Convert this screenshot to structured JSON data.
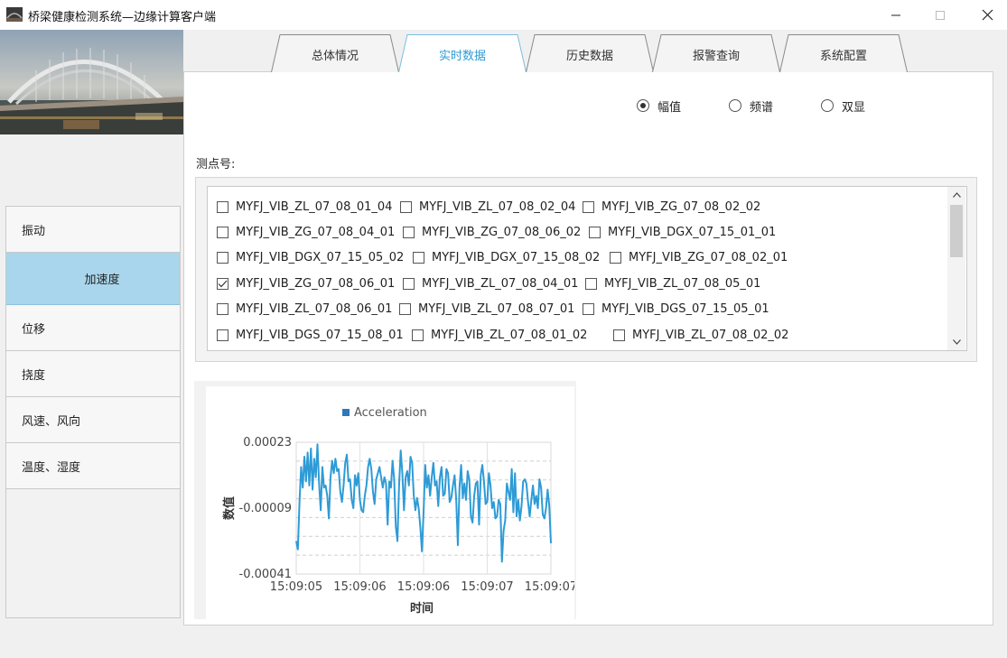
{
  "window": {
    "title": "桥梁健康检测系统—边缘计算客户端",
    "controls": {
      "minimize": "—",
      "maximize": "□",
      "close": "✕"
    }
  },
  "sidebar": {
    "items": [
      {
        "label": "振动",
        "active": false
      },
      {
        "label": "加速度",
        "active": true
      },
      {
        "label": "位移",
        "active": false
      },
      {
        "label": "挠度",
        "active": false
      },
      {
        "label": "风速、风向",
        "active": false
      },
      {
        "label": "温度、湿度",
        "active": false
      }
    ]
  },
  "tabs": [
    {
      "label": "总体情况",
      "active": false
    },
    {
      "label": "实时数据",
      "active": true
    },
    {
      "label": "历史数据",
      "active": false
    },
    {
      "label": "报警查询",
      "active": false
    },
    {
      "label": "系统配置",
      "active": false
    }
  ],
  "display_mode": {
    "options": [
      {
        "label": "幅值",
        "selected": true
      },
      {
        "label": "频谱",
        "selected": false
      },
      {
        "label": "双显",
        "selected": false
      }
    ]
  },
  "points": {
    "label": "测点号:",
    "rows": [
      [
        {
          "id": "MYFJ_VIB_ZL_07_08_01_04",
          "checked": false
        },
        {
          "id": "MYFJ_VIB_ZL_07_08_02_04",
          "checked": false
        },
        {
          "id": "MYFJ_VIB_ZG_07_08_02_02",
          "checked": false
        }
      ],
      [
        {
          "id": "MYFJ_VIB_ZG_07_08_04_01",
          "checked": false
        },
        {
          "id": "MYFJ_VIB_ZG_07_08_06_02",
          "checked": false
        },
        {
          "id": "MYFJ_VIB_DGX_07_15_01_01",
          "checked": false
        }
      ],
      [
        {
          "id": "MYFJ_VIB_DGX_07_15_05_02",
          "checked": false
        },
        {
          "id": "MYFJ_VIB_DGX_07_15_08_02",
          "checked": false
        },
        {
          "id": "MYFJ_VIB_ZG_07_08_02_01",
          "checked": false
        }
      ],
      [
        {
          "id": "MYFJ_VIB_ZG_07_08_06_01",
          "checked": true
        },
        {
          "id": "MYFJ_VIB_ZL_07_08_04_01",
          "checked": false
        },
        {
          "id": "MYFJ_VIB_ZL_07_08_05_01",
          "checked": false
        }
      ],
      [
        {
          "id": "MYFJ_VIB_ZL_07_08_06_01",
          "checked": false
        },
        {
          "id": "MYFJ_VIB_ZL_07_08_07_01",
          "checked": false
        },
        {
          "id": "MYFJ_VIB_DGS_07_15_05_01",
          "checked": false
        }
      ],
      [
        {
          "id": "MYFJ_VIB_DGS_07_15_08_01",
          "checked": false
        },
        {
          "id": "MYFJ_VIB_ZL_07_08_01_02",
          "checked": false
        },
        {
          "id": "MYFJ_VIB_ZL_07_08_02_02",
          "checked": false
        }
      ]
    ]
  },
  "chart_data": {
    "type": "line",
    "title": "",
    "xlabel": "时间",
    "ylabel": "数值",
    "legend": [
      "Acceleration"
    ],
    "legend_position": "top",
    "grid": true,
    "x_ticks": [
      "15:09:05",
      "15:09:06",
      "15:09:06",
      "15:09:07",
      "15:09:07"
    ],
    "y_ticks": [
      "0.00023",
      "-0.00009",
      "-0.00041"
    ],
    "ylim": [
      -0.00041,
      0.00023
    ],
    "series": [
      {
        "name": "Acceleration",
        "color": "#2e9bd6",
        "values": [
          -0.00025,
          -0.00029,
          -6e-05,
          0.00011,
          1e-05,
          0.00016,
          4e-05,
          0.00018,
          2e-05,
          0.0002,
          0.0,
          0.00015,
          6e-05,
          0.00022,
          3e-05,
          -0.0001,
          0.00011,
          1e-05,
          2e-05,
          -3e-05,
          -0.00014,
          6e-05,
          0.00014,
          8e-05,
          0.00015,
          9e-05,
          0.0001,
          -1e-05,
          -6e-05,
          2e-05,
          0.00013,
          0.00017,
          4e-05,
          5e-05,
          -5e-05,
          -9e-05,
          7e-05,
          2e-05,
          8e-05,
          -5e-05,
          -0.0001,
          -0.00011,
          -3e-05,
          2e-05,
          0.00011,
          0.00015,
          0.0001,
          -1e-05,
          -7e-05,
          5e-05,
          8e-05,
          0.00011,
          6e-05,
          1e-05,
          6e-05,
          3e-05,
          -0.00017,
          4e-05,
          1e-05,
          0.00014,
          5e-05,
          -0.00018,
          -0.00025,
          2e-05,
          0.00019,
          8e-05,
          -0.0001,
          6e-05,
          9e-05,
          2e-05,
          0.00016,
          0.00013,
          -3e-05,
          -0.0001,
          -4e-05,
          -9e-05,
          -0.00018,
          -0.0003,
          -0.00011,
          0.00012,
          1e-05,
          7e-05,
          -3e-05,
          6e-05,
          0.00013,
          2e-05,
          4e-05,
          -8e-05,
          6e-05,
          0.00011,
          -3e-05,
          -2e-05,
          0.0001,
          8e-05,
          -6e-05,
          -4e-05,
          2e-05,
          7e-05,
          -5e-05,
          -0.00027,
          1e-05,
          0.00012,
          -4e-05,
          3e-05,
          -5e-05,
          9e-05,
          5e-05,
          -0.00013,
          -0.00016,
          -3e-05,
          3e-05,
          4e-05,
          -0.00017,
          7e-05,
          0.00012,
          4e-05,
          -7e-05,
          -6e-05,
          8e-05,
          2e-05,
          -9e-05,
          -6e-05,
          -0.00014,
          -0.00013,
          -5e-05,
          -7e-05,
          -0.00035,
          -0.0002,
          -0.00015,
          3e-05,
          -1e-05,
          -5e-05,
          0.0001,
          -0.00011,
          8e-05,
          -0.00013,
          -5e-05,
          -0.00015,
          -8e-05,
          4e-05,
          5e-05,
          3e-05,
          -6e-05,
          -0.00013,
          -5e-05,
          2e-05,
          -7e-05,
          -3e-05,
          -9e-05,
          5e-05,
          1e-05,
          -0.00012,
          -0.00014,
          -9e-05,
          0.0,
          -8e-05,
          -0.00026
        ]
      }
    ]
  }
}
